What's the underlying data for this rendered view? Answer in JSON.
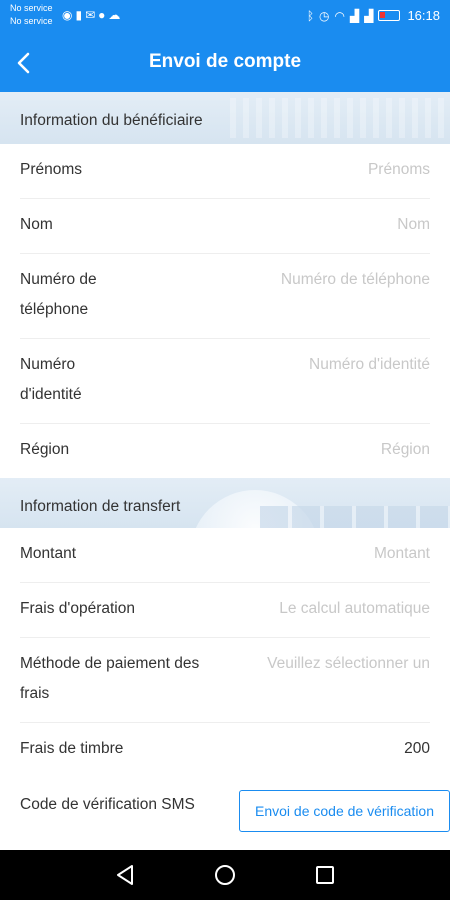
{
  "status_bar": {
    "carrier_1": "No service",
    "carrier_2": "No service",
    "time": "16:18",
    "icons_left": [
      "wifi-calling-icon",
      "sim-icon",
      "mail-icon",
      "facebook-icon",
      "cloud-icon"
    ],
    "icons_right": [
      "bluetooth-icon",
      "alarm-icon",
      "wifi-icon",
      "signal-icon",
      "signal-icon",
      "battery-icon"
    ]
  },
  "header": {
    "title": "Envoi de compte",
    "back_icon": "chevron-left-icon"
  },
  "beneficiary": {
    "title": "Information du bénéficiaire",
    "fields": [
      {
        "label": "Prénoms",
        "placeholder": "Prénoms"
      },
      {
        "label": "Nom",
        "placeholder": "Nom"
      },
      {
        "label": "Numéro de téléphone",
        "placeholder": "Numéro de téléphone"
      },
      {
        "label": "Numéro d'identité",
        "placeholder": "Numéro d'identité"
      },
      {
        "label": "Région",
        "placeholder": "Région"
      }
    ]
  },
  "transfer": {
    "title": "Information de transfert",
    "fields": [
      {
        "label": "Montant",
        "placeholder": "Montant"
      },
      {
        "label": "Frais d'opération",
        "placeholder": "Le calcul automatique"
      },
      {
        "label": "Méthode de paiement des frais",
        "placeholder": "Veuillez sélectionner un"
      },
      {
        "label": "Frais de timbre",
        "value": "200"
      },
      {
        "label": "Code de vérification SMS",
        "button": "Envoi de code de vérification"
      }
    ]
  },
  "colors": {
    "primary": "#1a8cf0",
    "placeholder": "#c8c8c8",
    "text": "#333333",
    "nav_bar": "#000000"
  },
  "nav": {
    "back_icon": "triangle-back-icon",
    "home_icon": "circle-home-icon",
    "recents_icon": "square-recents-icon"
  }
}
